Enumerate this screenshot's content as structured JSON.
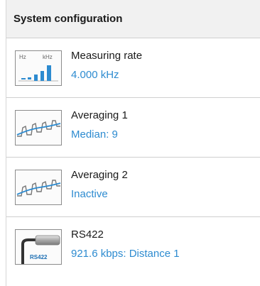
{
  "header": {
    "title": "System configuration"
  },
  "items": [
    {
      "title": "Measuring rate",
      "value": "4.000 kHz",
      "icon": "measuring-rate-icon",
      "icon_labels": [
        "Hz",
        "kHz"
      ]
    },
    {
      "title": "Averaging 1",
      "value": "Median: 9",
      "icon": "averaging-wave-icon"
    },
    {
      "title": "Averaging 2",
      "value": "Inactive",
      "icon": "averaging-wave-icon"
    },
    {
      "title": "RS422",
      "value": "921.6 kbps: Distance 1",
      "icon": "rs422-cable-icon",
      "icon_label": "RS422"
    }
  ],
  "colors": {
    "value_text": "#2d8bd0",
    "header_bg": "#f1f1f1"
  }
}
